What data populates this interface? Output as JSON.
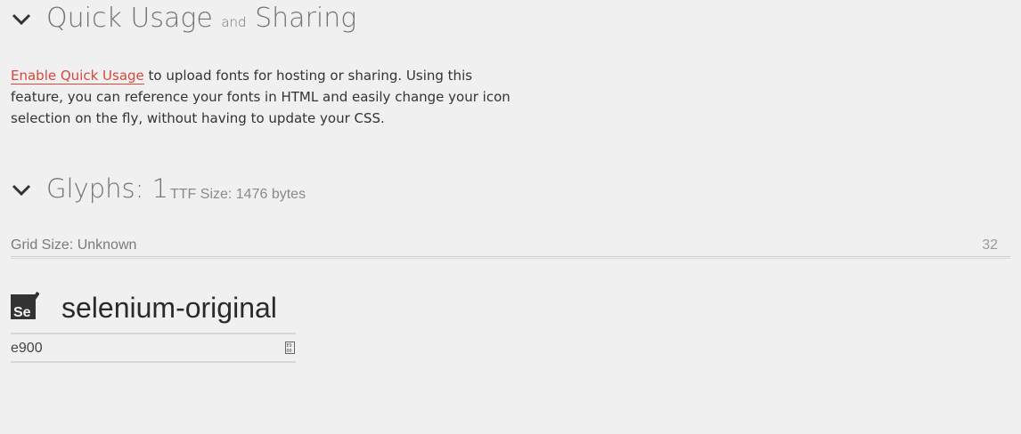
{
  "quick_usage": {
    "title_main": "Quick Usage",
    "title_and": "and",
    "title_end": "Sharing",
    "enable_link": "Enable Quick Usage",
    "description": " to upload fonts for hosting or sharing. Using this feature, you can reference your fonts in HTML and easily change your icon selection on the fly, without having to update your CSS."
  },
  "glyphs": {
    "title": "Glyphs: 1",
    "ttf_size": "TTF Size: 1476 bytes",
    "grid_label": "Grid Size: Unknown",
    "grid_value": "32"
  },
  "glyph_item": {
    "name": "selenium-original",
    "code": "e900",
    "icon": "selenium-icon",
    "code_icon": "glyph-code-icon"
  },
  "colors": {
    "background": "#f0f0f0",
    "link": "#d9463b",
    "heading": "#737373"
  }
}
